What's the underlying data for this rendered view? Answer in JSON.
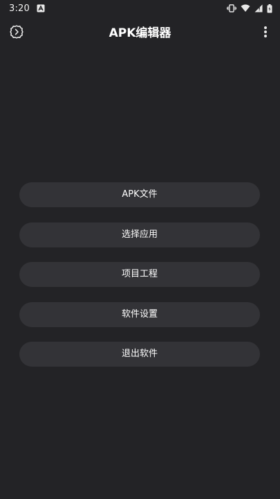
{
  "status_bar": {
    "time": "3:20"
  },
  "app_bar": {
    "title": "APK编辑器"
  },
  "menu": {
    "items": [
      {
        "label": "APK文件"
      },
      {
        "label": "选择应用"
      },
      {
        "label": "项目工程"
      },
      {
        "label": "软件设置"
      },
      {
        "label": "退出软件"
      }
    ]
  },
  "colors": {
    "background": "#232326",
    "button": "#333337",
    "text": "#ffffff"
  },
  "icons": {
    "status_notification": "a-notification-icon",
    "status_vibrate": "vibrate-icon",
    "status_wifi": "wifi-icon",
    "status_signal": "signal-icon",
    "status_battery": "battery-icon",
    "app_settings": "gear-icon",
    "app_more": "more-vert-icon"
  }
}
